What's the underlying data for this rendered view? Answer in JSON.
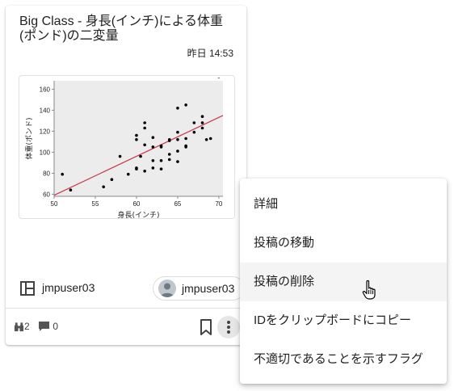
{
  "card": {
    "title": "Big Class - 身長(インチ)による体重(ポンド)の二変量",
    "timestamp": "昨日 14:53",
    "owner_name": "jmpuser03",
    "author_name": "jmpuser03",
    "views_count": "2",
    "comments_count": "0"
  },
  "chart_data": {
    "type": "scatter",
    "xlabel": "身長(インチ)",
    "ylabel": "体重(ポンド)",
    "x_ticks": [
      "50",
      "55",
      "60",
      "65",
      "70"
    ],
    "y_ticks": [
      "60",
      "80",
      "100",
      "120",
      "140",
      "160"
    ],
    "xlim": [
      50,
      70.5
    ],
    "ylim": [
      58,
      168
    ],
    "points": [
      [
        51,
        79
      ],
      [
        52,
        64
      ],
      [
        56,
        67
      ],
      [
        57,
        74
      ],
      [
        58,
        96
      ],
      [
        59,
        79
      ],
      [
        60,
        85
      ],
      [
        60,
        84
      ],
      [
        60,
        112
      ],
      [
        60,
        116
      ],
      [
        60.5,
        96
      ],
      [
        61,
        107
      ],
      [
        61,
        123
      ],
      [
        61,
        128
      ],
      [
        61,
        82
      ],
      [
        62,
        105
      ],
      [
        62,
        114
      ],
      [
        62,
        92
      ],
      [
        62,
        85
      ],
      [
        63,
        84
      ],
      [
        63,
        92
      ],
      [
        63,
        105
      ],
      [
        63,
        106
      ],
      [
        64,
        98
      ],
      [
        64,
        112
      ],
      [
        64,
        93
      ],
      [
        64,
        111
      ],
      [
        65,
        112
      ],
      [
        65,
        101
      ],
      [
        65,
        91
      ],
      [
        65,
        119
      ],
      [
        65,
        142
      ],
      [
        66,
        105
      ],
      [
        66,
        106
      ],
      [
        66,
        113
      ],
      [
        66,
        145
      ],
      [
        67,
        128
      ],
      [
        67,
        119
      ],
      [
        68,
        123
      ],
      [
        68,
        128
      ],
      [
        68,
        134
      ],
      [
        68.5,
        112
      ],
      [
        69,
        113
      ],
      [
        70,
        172
      ]
    ],
    "fit_line": {
      "x": [
        50,
        70.5
      ],
      "y": [
        59,
        135
      ]
    },
    "fit_color": "#c8384a",
    "point_color": "#000000",
    "grid": false
  },
  "context_menu": {
    "items": [
      {
        "label": "詳細"
      },
      {
        "label": "投稿の移動"
      },
      {
        "label": "投稿の削除",
        "hovered": true
      },
      {
        "label": "IDをクリップボードにコピー"
      },
      {
        "label": "不適切であることを示すフラグ"
      }
    ]
  },
  "icons": {
    "owner": "space-icon",
    "views": "binoculars-icon",
    "comments": "comment-icon",
    "bookmark": "bookmark-icon",
    "more": "more-vertical-icon",
    "avatar": "person-icon"
  }
}
